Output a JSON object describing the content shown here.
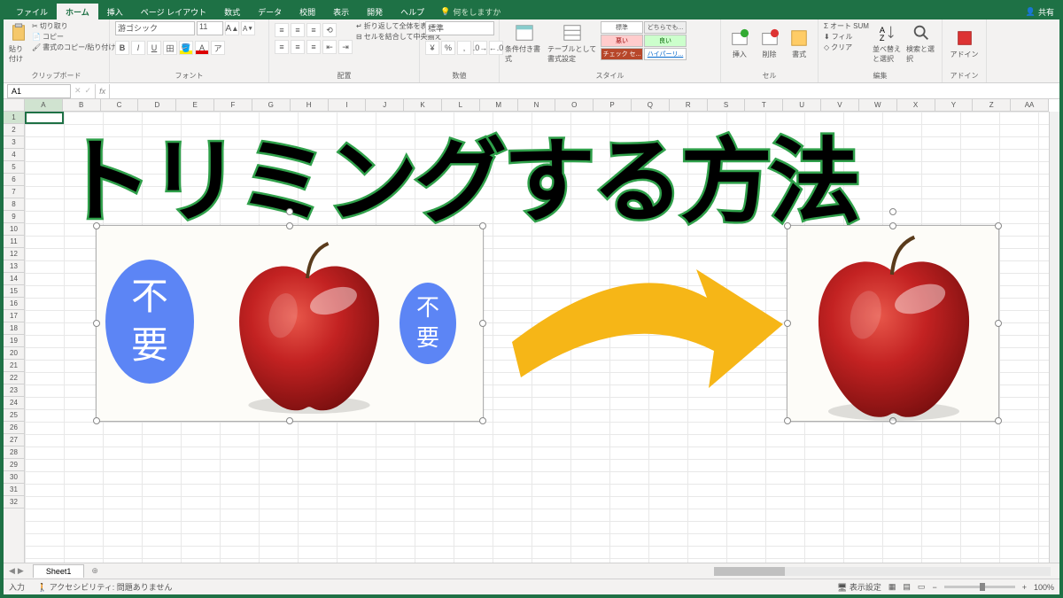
{
  "titlebar": {
    "share": "共有"
  },
  "ribbon_tabs": [
    "ファイル",
    "ホーム",
    "挿入",
    "ページ レイアウト",
    "数式",
    "データ",
    "校閲",
    "表示",
    "開発",
    "ヘルプ"
  ],
  "tell_me": "何をしますか",
  "ribbon": {
    "clipboard": {
      "label": "クリップボード",
      "paste": "貼り付け",
      "cut": "切り取り",
      "copy": "コピー",
      "format_painter": "書式のコピー/貼り付け"
    },
    "font": {
      "label": "フォント",
      "name": "游ゴシック",
      "size": "11",
      "bold": "B",
      "italic": "I",
      "underline": "U",
      "increase": "A",
      "decrease": "A"
    },
    "alignment": {
      "label": "配置",
      "wrap": "折り返して全体を表示する",
      "merge": "セルを結合して中央揃え"
    },
    "number": {
      "label": "数値",
      "format": "標準"
    },
    "styles": {
      "label": "スタイル",
      "cond": "条件付き書式",
      "table": "テーブルとして書式設定",
      "chips": [
        "標準",
        "どちらでも...",
        "悪い",
        "良い",
        "チェック セ...",
        "ハイパーリ..."
      ]
    },
    "cells": {
      "label": "セル",
      "insert": "挿入",
      "delete": "削除",
      "format": "書式"
    },
    "editing": {
      "label": "編集",
      "autosum": "オート SUM",
      "fill": "フィル",
      "clear": "クリア",
      "sort": "並べ替えと選択",
      "find": "検索と選択"
    },
    "addins": {
      "label": "アドイン",
      "btn": "アドイン"
    }
  },
  "formula_bar": {
    "cell_ref": "A1",
    "formula": ""
  },
  "columns": [
    "A",
    "B",
    "C",
    "D",
    "E",
    "F",
    "G",
    "H",
    "I",
    "J",
    "K",
    "L",
    "M",
    "N",
    "O",
    "P",
    "Q",
    "R",
    "S",
    "T",
    "U",
    "V",
    "W",
    "X",
    "Y",
    "Z",
    "AA"
  ],
  "rows": [
    "1",
    "2",
    "3",
    "4",
    "5",
    "6",
    "7",
    "8",
    "9",
    "10",
    "11",
    "12",
    "13",
    "14",
    "15",
    "16",
    "17",
    "18",
    "19",
    "20",
    "21",
    "22",
    "23",
    "24",
    "25",
    "26",
    "27",
    "28",
    "29",
    "30",
    "31",
    "32"
  ],
  "wordart": "トリミングする方法",
  "badge1_l1": "不",
  "badge1_l2": "要",
  "badge2_l1": "不",
  "badge2_l2": "要",
  "sheet": {
    "name": "Sheet1"
  },
  "status": {
    "mode": "入力",
    "accessibility": "アクセシビリティ: 問題ありません",
    "display": "表示設定",
    "zoom": "100%"
  }
}
